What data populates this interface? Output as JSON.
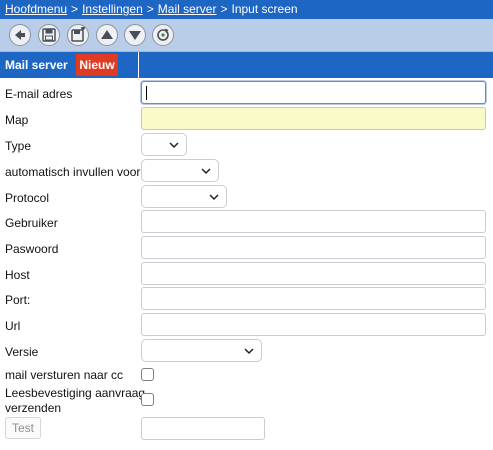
{
  "breadcrumb": {
    "items": [
      "Hoofdmenu",
      "Instellingen",
      "Mail server"
    ],
    "separator": ">",
    "current": "Input screen"
  },
  "toolbar": {
    "buttons": [
      "back-icon",
      "save-icon",
      "save-new-icon",
      "up-icon",
      "down-icon",
      "refresh-icon"
    ]
  },
  "tab": {
    "title": "Mail server",
    "badge": "Nieuw"
  },
  "form": {
    "email_label": "E-mail adres",
    "email_value": "",
    "map_label": "Map",
    "map_value": "",
    "type_label": "Type",
    "type_value": "",
    "autofill_label": "automatisch invullen voor",
    "autofill_value": "",
    "protocol_label": "Protocol",
    "protocol_value": "",
    "user_label": "Gebruiker",
    "user_value": "",
    "password_label": "Paswoord",
    "password_value": "",
    "host_label": "Host",
    "host_value": "",
    "port_label": "Port:",
    "port_value": "",
    "url_label": "Url",
    "url_value": "",
    "version_label": "Versie",
    "version_value": "",
    "cc_label": "mail versturen naar cc",
    "cc_checked": false,
    "read_receipt_label_line1": "Leesbevestiging aanvraag",
    "read_receipt_label_line2": "verzenden",
    "read_receipt_checked": false,
    "test_button": "Test",
    "test_value": ""
  },
  "colors": {
    "header_blue": "#1e66c4",
    "toolbar": "#b9cde9",
    "badge_red": "#e03a22",
    "map_highlight": "#fafac9"
  }
}
